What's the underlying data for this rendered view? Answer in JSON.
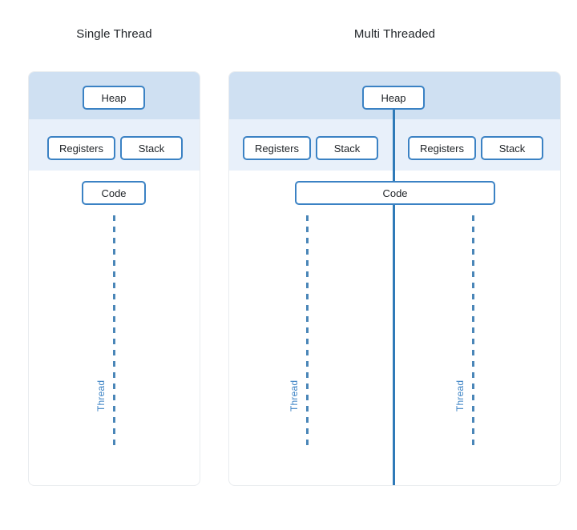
{
  "diagram": {
    "panels": [
      {
        "title": "Single Thread",
        "heap_label": "Heap",
        "code_label": "Code",
        "threads": [
          {
            "registers_label": "Registers",
            "stack_label": "Stack",
            "thread_label": "Thread"
          }
        ]
      },
      {
        "title": "Multi Threaded",
        "heap_label": "Heap",
        "code_label": "Code",
        "threads": [
          {
            "registers_label": "Registers",
            "stack_label": "Stack",
            "thread_label": "Thread"
          },
          {
            "registers_label": "Registers",
            "stack_label": "Stack",
            "thread_label": "Thread"
          }
        ]
      }
    ],
    "colors": {
      "heap_band": "#cfe0f2",
      "registers_band": "#e8f0fa",
      "box_border": "#3b82c4",
      "thread_line": "#4a86b8",
      "divider_line": "#2f7ab8",
      "card_border": "#e9ecef",
      "title_text": "#212529",
      "background": "#ffffff"
    }
  }
}
